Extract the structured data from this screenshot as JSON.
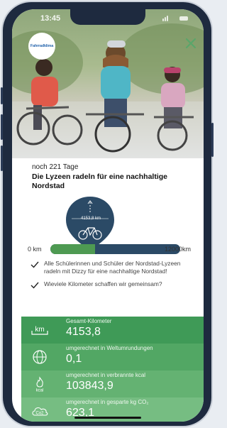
{
  "status_bar": {
    "time": "13:45"
  },
  "header": {
    "logo_text": "Fahrradklima",
    "close_icon": "close-icon"
  },
  "challenge": {
    "days_left": "noch 221 Tage",
    "title": "Die Lyzeen radeln für eine nachhaltige Nordstad"
  },
  "progress": {
    "start_label": "0 km",
    "end_label": "12000km",
    "marker_label": "4153,8 km",
    "current_km": 4153.8,
    "goal_km": 12000
  },
  "checks": [
    {
      "text": "Alle Schülerinnen und Schüler der Nordstad-Lyzeen radeln mit Dizzy für eine nachhaltige Nordstad!"
    },
    {
      "text": "Wieviele Kilometer schaffen wir gemeinsam?"
    }
  ],
  "stats": [
    {
      "icon": "km-icon",
      "icon_text": "km",
      "label": "Gesamt-Kilometer",
      "value": "4153,8",
      "color": "#3f9a57"
    },
    {
      "icon": "globe-icon",
      "icon_text": "",
      "label": "umgerechnet in Weltumrundungen",
      "value": "0,1",
      "color": "#52a764"
    },
    {
      "icon": "flame-icon",
      "icon_text": "kcal",
      "label": "umgerechnet in verbrannte kcal",
      "value": "103843,9",
      "color": "#64b272"
    },
    {
      "icon": "co2-icon",
      "icon_text": "Co2",
      "label": "umgerechnet in gesparte kg CO₂",
      "value": "623,1",
      "color": "#76bd82"
    }
  ]
}
